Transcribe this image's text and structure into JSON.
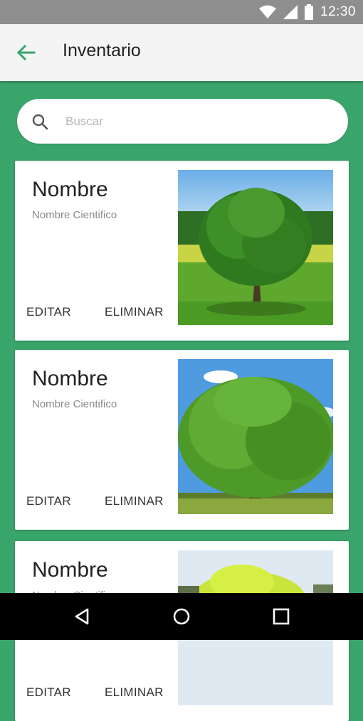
{
  "status_bar": {
    "time": "12:30",
    "icons": [
      "wifi-icon",
      "signal-icon",
      "battery-icon"
    ]
  },
  "app_bar": {
    "title": "Inventario",
    "back_icon": "arrow-back-icon"
  },
  "search": {
    "placeholder": "Buscar",
    "value": "",
    "icon": "search-icon"
  },
  "items": [
    {
      "name": "Nombre",
      "scientific_name": "Nombre Cientifico",
      "edit_label": "EDITAR",
      "delete_label": "ELIMINAR"
    },
    {
      "name": "Nombre",
      "scientific_name": "Nombre Cientifico",
      "edit_label": "EDITAR",
      "delete_label": "ELIMINAR"
    },
    {
      "name": "Nombre",
      "scientific_name": "Nombre Cientifico",
      "edit_label": "EDITAR",
      "delete_label": "ELIMINAR"
    }
  ],
  "nav_bar": {
    "icons": [
      "back-triangle-icon",
      "home-circle-icon",
      "recents-square-icon"
    ]
  },
  "colors": {
    "background": "#3aa56b",
    "accent": "#3aa56b",
    "app_bar": "#f4f4f4",
    "status_bar": "#8e8e8e"
  }
}
